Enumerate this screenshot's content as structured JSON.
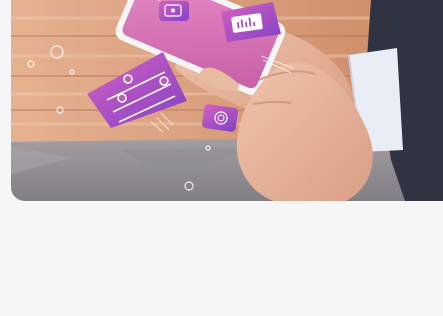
{
  "page": {
    "background_color": "#f6f6f6"
  },
  "hero_image": {
    "alt": "",
    "colors": {
      "brick_light": "#d9a27e",
      "brick_dark": "#b97958",
      "floor": "#8e8d91",
      "skin": "#e8b79a",
      "phone_screen": "#d86fb4",
      "card_purple": "#8d45c7",
      "card_pink": "#cf5ab8",
      "suit": "#2a2d3b",
      "shirt": "#e9eef6"
    },
    "floating_icons": [
      "music-app-icon",
      "chat-app-icon",
      "equalizer-icon",
      "image-app-icon",
      "fingerprint-app-icon"
    ]
  }
}
